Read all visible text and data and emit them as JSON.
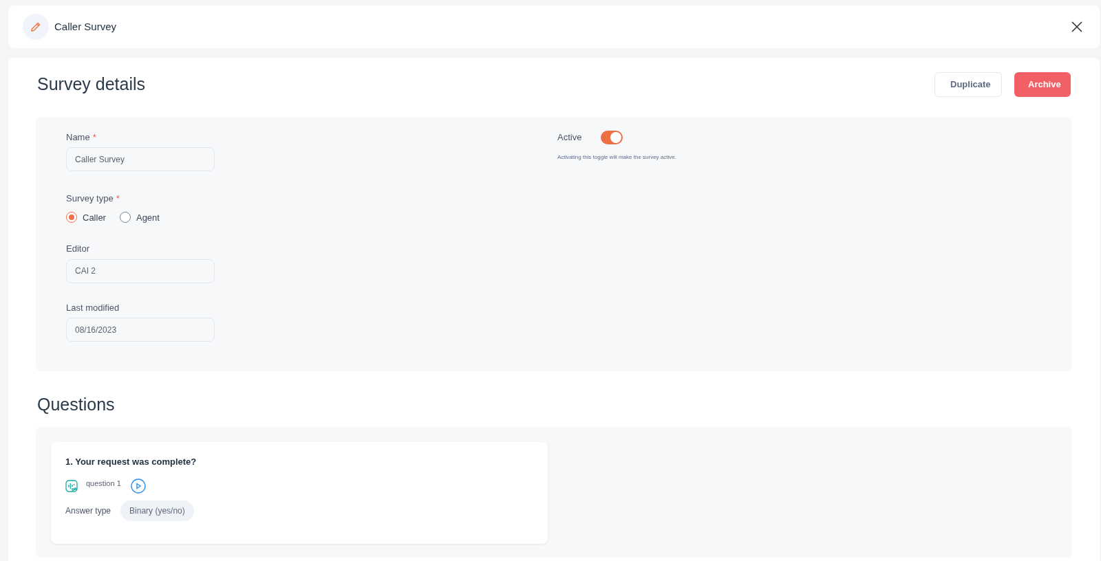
{
  "header": {
    "title": "Caller Survey"
  },
  "details": {
    "title": "Survey details",
    "buttons": [
      {
        "label": "Duplicate",
        "kind": "secondary"
      },
      {
        "label": "Archive",
        "kind": "danger"
      }
    ]
  },
  "form": {
    "fields": [
      {
        "kind": "text",
        "label": "Name",
        "required_mark": "*",
        "value": "Caller Survey"
      },
      {
        "kind": "radio",
        "label": "Survey type",
        "required_mark": "*",
        "options": [
          {
            "label": "Caller",
            "selected": true
          },
          {
            "label": "Agent",
            "selected": false
          }
        ]
      },
      {
        "kind": "text",
        "label": "Editor",
        "value": "CAI 2"
      },
      {
        "kind": "text",
        "label": "Last modified",
        "value": "08/16/2023"
      }
    ],
    "active": {
      "label": "Active",
      "on": true,
      "description": "Activating this toggle will make the survey active."
    }
  },
  "questions": {
    "title": "Questions",
    "items": [
      {
        "title": "1. Your request was complete?",
        "audio": "question 1",
        "answer_label": "Answer type",
        "answer_type": "Binary (yes/no)"
      }
    ]
  }
}
